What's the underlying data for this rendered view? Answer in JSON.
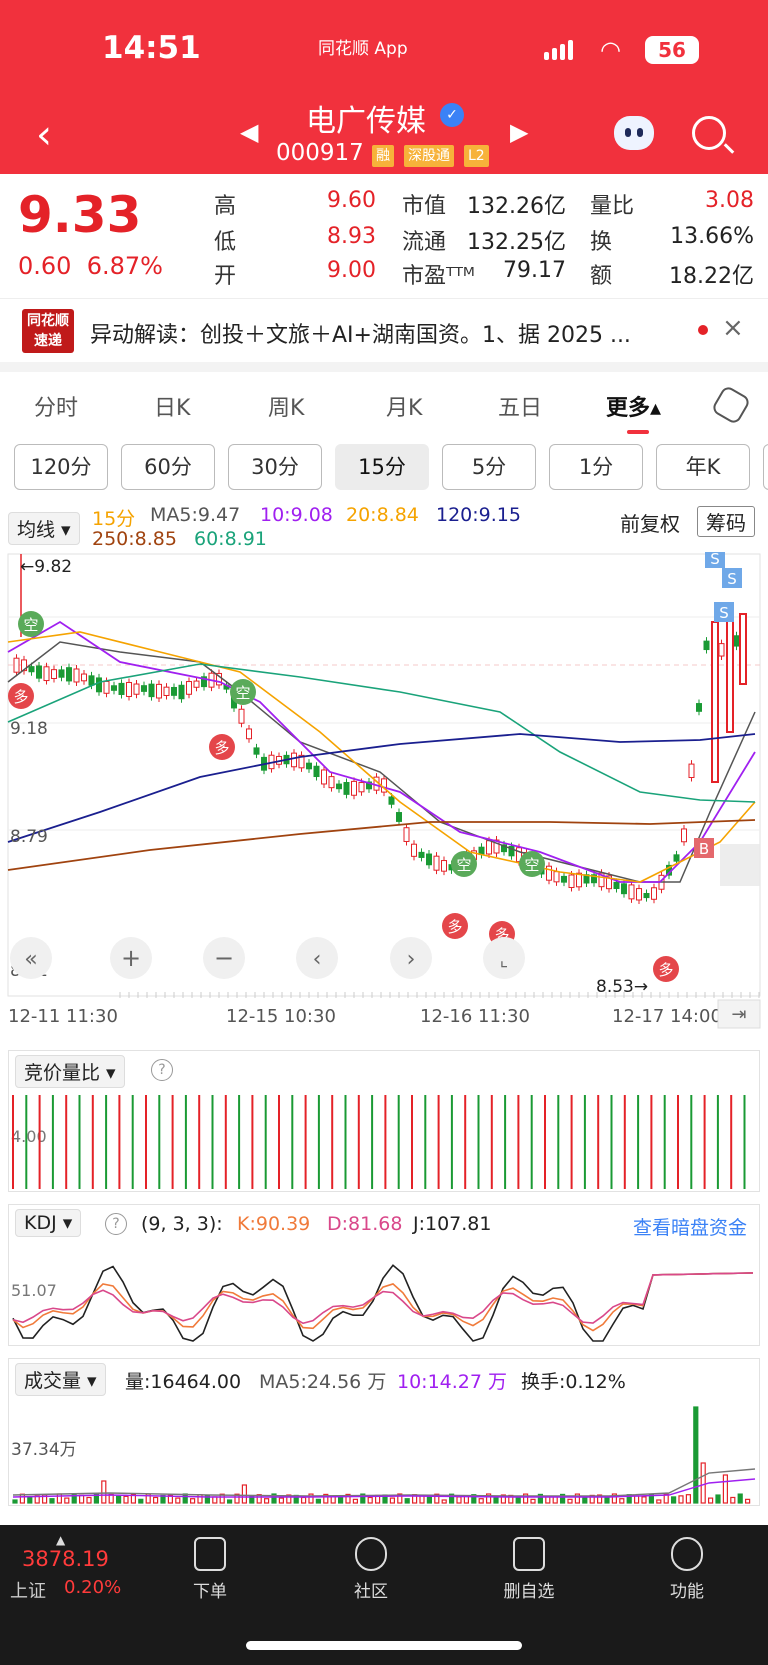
{
  "status_bar": {
    "time": "14:51",
    "app_label": "同花顺 App",
    "battery": "56"
  },
  "header": {
    "title": "电广传媒",
    "code": "000917",
    "tags": [
      "融",
      "深股通",
      "L2"
    ]
  },
  "quote": {
    "price": "9.33",
    "change": "0.60",
    "change_pct": "6.87%",
    "rows": [
      {
        "k1": "高",
        "v1": "9.60",
        "k2": "市值",
        "v2": "132.26亿",
        "k3": "量比",
        "v3": "3.08"
      },
      {
        "k1": "低",
        "v1": "8.93",
        "k2": "流通",
        "v2": "132.25亿",
        "k3": "换",
        "v3": "13.66%"
      },
      {
        "k1": "开",
        "v1": "9.00",
        "k2": "市盈ᵀᵀᴹ",
        "v2": "79.17",
        "k3": "额",
        "v3": "18.22亿"
      }
    ]
  },
  "news": {
    "logo_top": "同花顺",
    "logo_bottom": "速递",
    "text": "异动解读：创投＋文旅＋AI+湖南国资。1、据 2025 ..."
  },
  "tabs": [
    {
      "label": "分时"
    },
    {
      "label": "日K"
    },
    {
      "label": "周K"
    },
    {
      "label": "月K"
    },
    {
      "label": "五日"
    },
    {
      "label": "更多▴"
    }
  ],
  "periods": [
    "120分",
    "60分",
    "30分",
    "15分",
    "5分",
    "1分",
    "年K"
  ],
  "ma_bar": {
    "selector": "均线 ▾",
    "period": "15分",
    "ma5": "MA5:9.47",
    "ma10": "10:9.08",
    "ma20": "20:8.84",
    "ma120": "120:9.15",
    "ma250": "250:8.85",
    "ma60": "60:8.91",
    "adjust": "前复权",
    "chips": "筹码"
  },
  "main_chart": {
    "y_labels": [
      "9.82",
      "9.18",
      "8.79",
      "8.41"
    ],
    "high_marker": "←9.82",
    "low_marker": "8.53→",
    "x_labels": [
      "12-11 11:30",
      "12-15 10:30",
      "12-16 11:30",
      "12-17 14:00"
    ],
    "signals": {
      "long": "多",
      "short": "空",
      "sell": "S",
      "buy": "B"
    }
  },
  "panels": {
    "auction": {
      "label": "竞价量比 ▾",
      "level": "4.00"
    },
    "kdj": {
      "label": "KDJ ▾",
      "params": "(9, 3, 3):",
      "k": "K:90.39",
      "d": "D:81.68",
      "j": "J:107.81",
      "link": "查看暗盘资金",
      "level": "51.07"
    },
    "volume": {
      "label": "成交量 ▾",
      "vol": "量:16464.00",
      "ma5": "MA5:24.56 万",
      "ma10": "10:14.27 万",
      "turnover": "换手:0.12%",
      "level": "37.34万"
    }
  },
  "colors": {
    "up": "#e42228",
    "down": "#1a9a34",
    "ma5": "#555555",
    "ma10": "#a020f0",
    "ma20": "#f5a300",
    "ma60": "#1aa37a",
    "ma120": "#1a1f8f",
    "ma250": "#a0430f"
  },
  "bottom_bar": {
    "index_value": "3878.19",
    "index_name": "上证",
    "index_pct": "0.20%",
    "items": [
      {
        "label": "下单"
      },
      {
        "label": "社区"
      },
      {
        "label": "删自选"
      },
      {
        "label": "功能"
      }
    ]
  }
}
